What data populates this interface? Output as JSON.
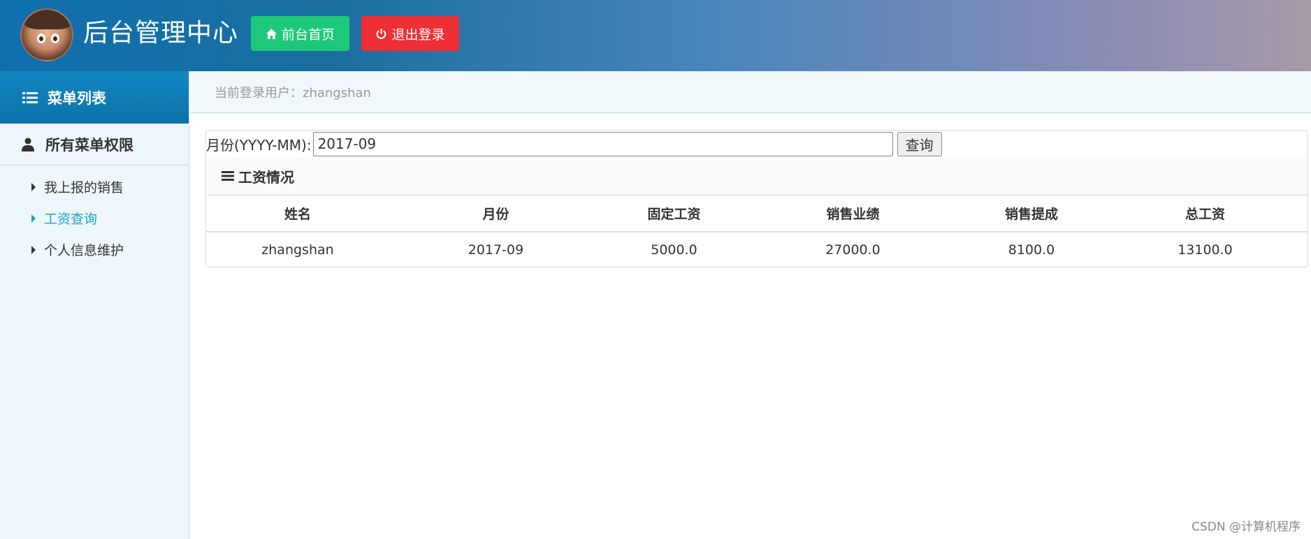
{
  "header": {
    "title": "后台管理中心",
    "home_button": "前台首页",
    "logout_button": "退出登录"
  },
  "sidebar": {
    "heading": "菜单列表",
    "group": "所有菜单权限",
    "items": [
      {
        "label": "我上报的销售",
        "active": false
      },
      {
        "label": "工资查询",
        "active": true
      },
      {
        "label": "个人信息维护",
        "active": false
      }
    ]
  },
  "breadcrumb": "当前登录用户：zhangshan",
  "search": {
    "label": "月份(YYYY-MM):",
    "value": "2017-09",
    "button": "查询"
  },
  "panel": {
    "title": "工资情况"
  },
  "table": {
    "columns": [
      "姓名",
      "月份",
      "固定工资",
      "销售业绩",
      "销售提成",
      "总工资"
    ],
    "rows": [
      [
        "zhangshan",
        "2017-09",
        "5000.0",
        "27000.0",
        "8100.0",
        "13100.0"
      ]
    ]
  },
  "watermark": "CSDN @计算机程序",
  "colors": {
    "home_button": "#1ec87a",
    "logout_button": "#ee2f35",
    "active_menu": "#1ba3d6",
    "sidebar_head": "#0b73aa"
  },
  "icons": {
    "home_button": "home-icon",
    "logout_button": "power-icon",
    "sidebar_heading": "list-icon",
    "group": "user-icon",
    "panel_title": "bars-icon"
  }
}
